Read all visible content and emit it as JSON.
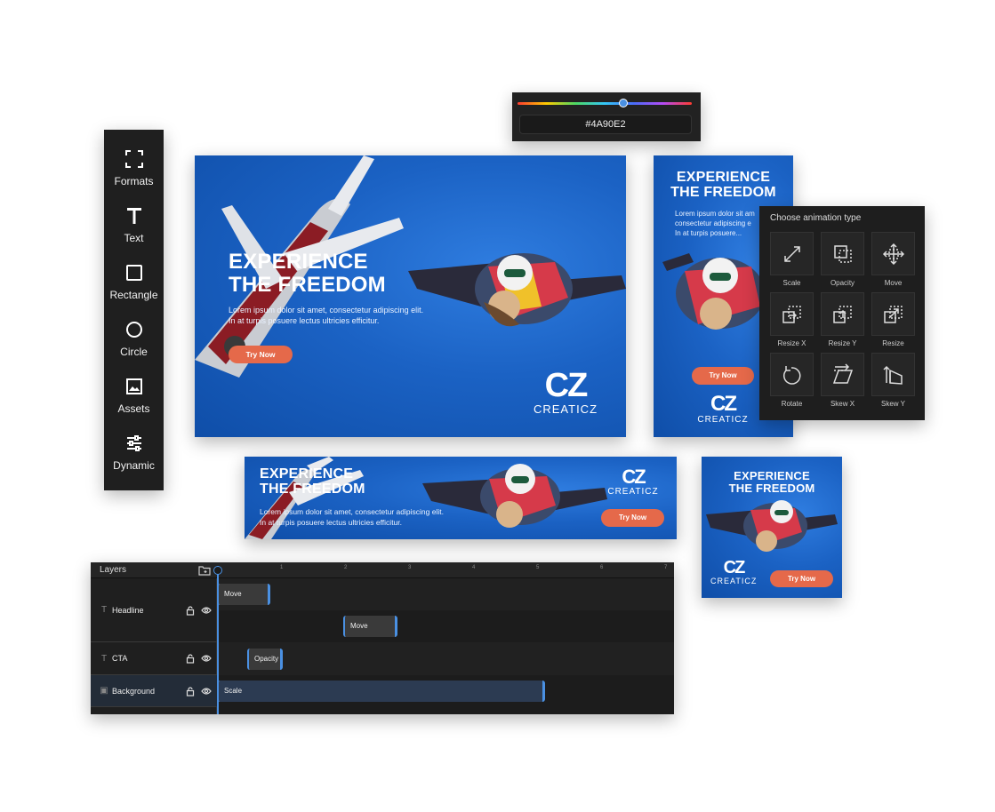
{
  "toolbar": {
    "items": [
      {
        "label": "Formats",
        "icon": "frame-corners-icon"
      },
      {
        "label": "Text",
        "icon": "text-t-icon"
      },
      {
        "label": "Rectangle",
        "icon": "rectangle-icon"
      },
      {
        "label": "Circle",
        "icon": "circle-icon"
      },
      {
        "label": "Assets",
        "icon": "image-icon"
      },
      {
        "label": "Dynamic",
        "icon": "sliders-icon"
      }
    ]
  },
  "color_picker": {
    "hex": "#4A90E2",
    "hue_position": 0.58
  },
  "banners": {
    "headline_line1": "EXPERIENCE",
    "headline_line2": "THE FREEDOM",
    "body_line1": "Lorem ipsum dolor sit amet, consectetur adipiscing elit.",
    "body_line2": "In at turpis posuere lectus ultricies efficitur.",
    "body_tall_line1": "Lorem ipsum dolor sit am",
    "body_tall_line2": "consectetur adipiscing e",
    "body_tall_line3": "In at turpis posuere...",
    "cta_label": "Try Now",
    "logo_mark": "CZ",
    "logo_word": "CREATICZ",
    "brand_blue": "#1b62c4",
    "cta_color": "#e5694a"
  },
  "animation_panel": {
    "title": "Choose animation type",
    "items": [
      {
        "label": "Scale",
        "icon": "scale-icon"
      },
      {
        "label": "Opacity",
        "icon": "opacity-icon"
      },
      {
        "label": "Move",
        "icon": "move-icon"
      },
      {
        "label": "Resize X",
        "icon": "resize-x-icon"
      },
      {
        "label": "Resize Y",
        "icon": "resize-y-icon"
      },
      {
        "label": "Resize",
        "icon": "resize-icon"
      },
      {
        "label": "Rotate",
        "icon": "rotate-icon"
      },
      {
        "label": "Skew X",
        "icon": "skew-x-icon"
      },
      {
        "label": "Skew Y",
        "icon": "skew-y-icon"
      }
    ]
  },
  "timeline": {
    "title": "Layers",
    "ticks": [
      "1",
      "2",
      "3",
      "4",
      "5",
      "6",
      "7"
    ],
    "layers": [
      {
        "name": "Headline",
        "icon": "text-t-icon"
      },
      {
        "name": "CTA",
        "icon": "text-t-icon"
      },
      {
        "name": "Background",
        "icon": "image-icon"
      }
    ],
    "clips": {
      "headline_1": "Move",
      "headline_2": "Move",
      "cta": "Opacity",
      "background": "Scale"
    },
    "accent": "#4a90e2"
  }
}
